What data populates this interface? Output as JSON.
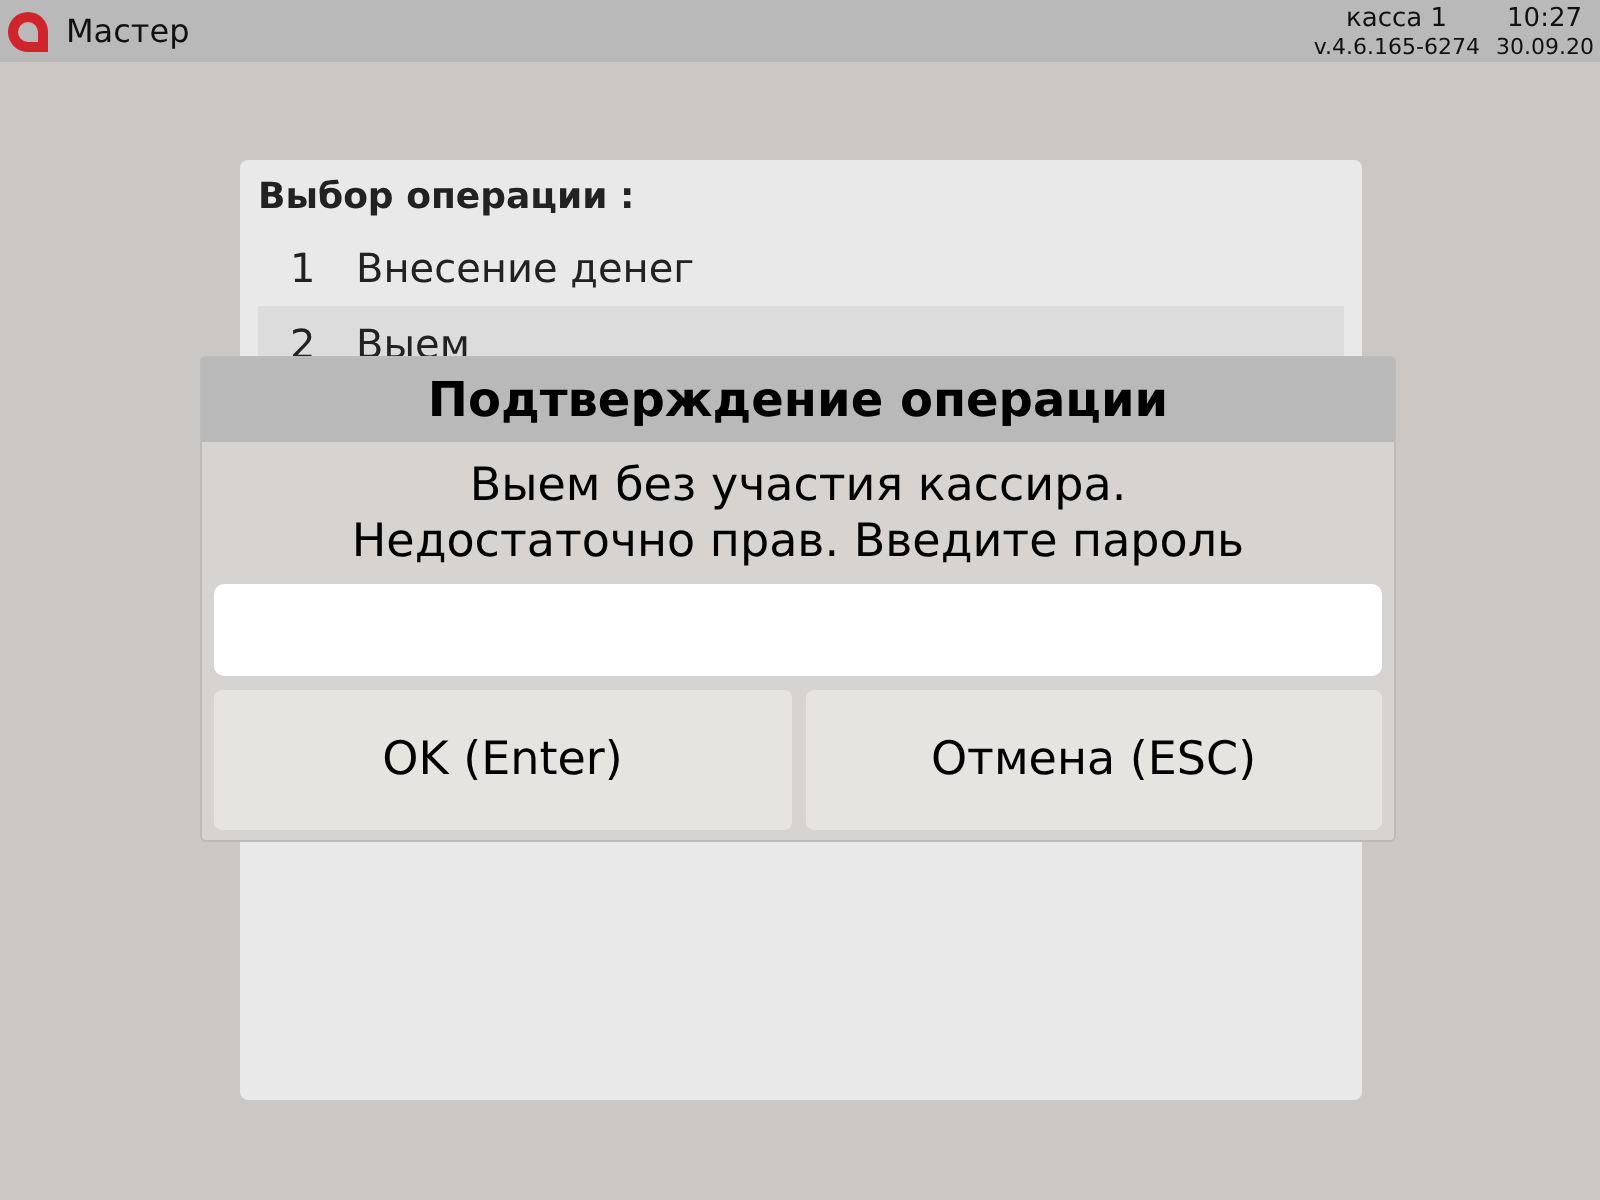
{
  "top_bar": {
    "title": "Мастер",
    "register": "касса 1",
    "time": "10:27",
    "version": "v.4.6.165-6274",
    "date": "30.09.20"
  },
  "menu": {
    "title": "Выбор операции :",
    "items": [
      {
        "number": "1",
        "label": "Внесение денег",
        "selected": false
      },
      {
        "number": "2",
        "label": "Выем",
        "selected": true
      }
    ]
  },
  "dialog": {
    "title": "Подтверждение операции",
    "message": [
      "Выем без участия кассира.",
      "Недостаточно прав. Введите пароль"
    ],
    "buttons": [
      "OK (Enter)",
      "Отмена (ESC)"
    ]
  }
}
